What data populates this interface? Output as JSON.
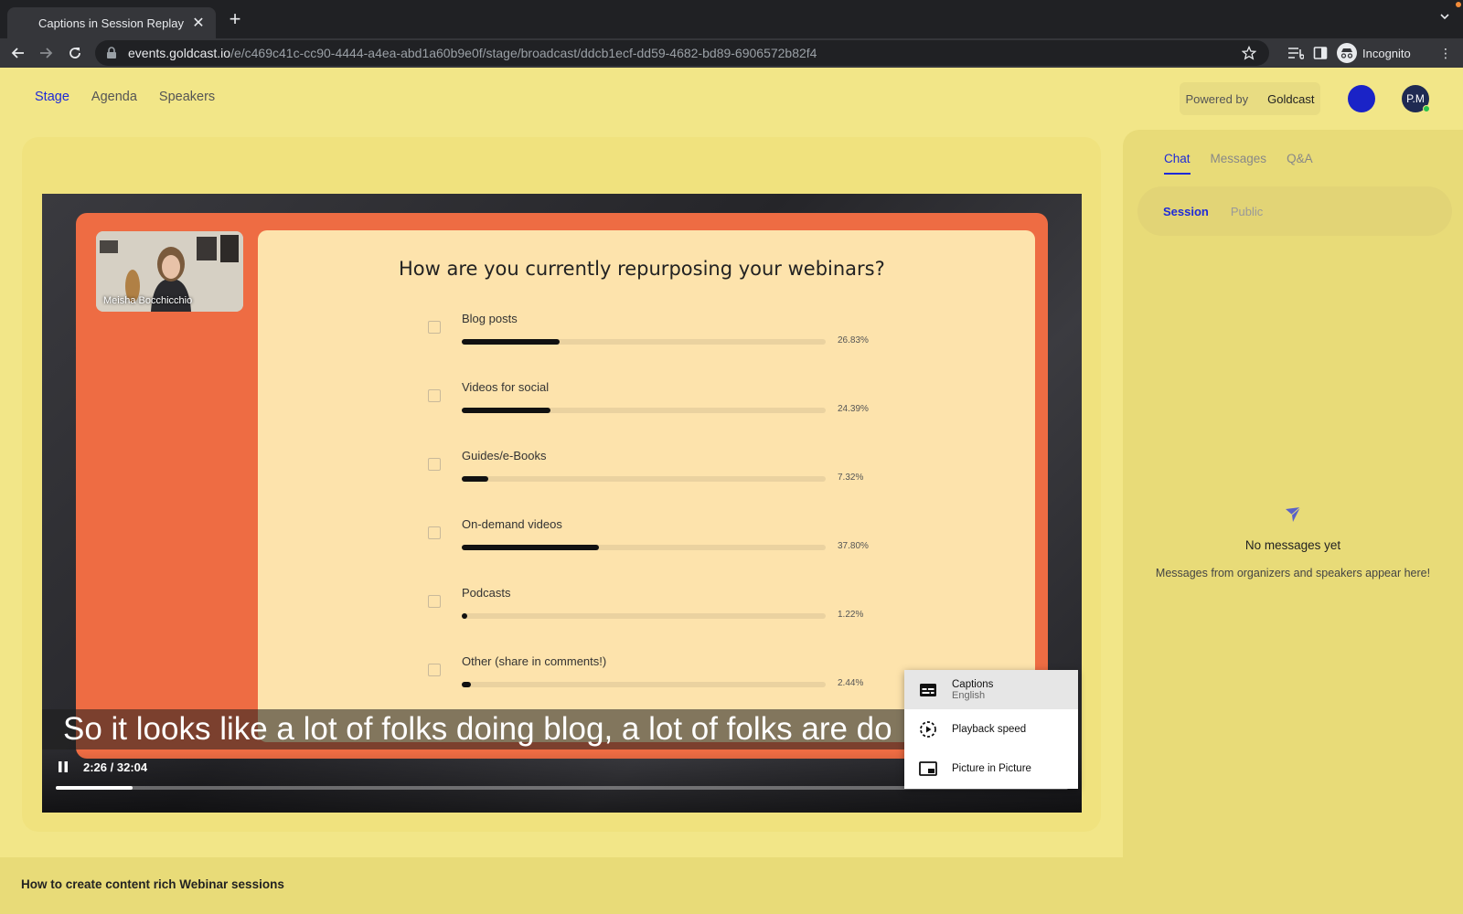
{
  "browser": {
    "tab_title": "Captions in Session Replay",
    "url_host": "events.goldcast.io",
    "url_path": "/e/c469c41c-cc90-4444-a4ea-abd1a60b9e0f/stage/broadcast/ddcb1ecf-dd59-4682-bd89-6906572b82f4",
    "incognito_label": "Incognito"
  },
  "header": {
    "nav": [
      "Stage",
      "Agenda",
      "Speakers"
    ],
    "active_nav": "Stage",
    "powered_by": "Powered by",
    "brand": "Goldcast",
    "user_initials": "P.M",
    "colors": {
      "accent": "#1e2ad8",
      "background": "#f2e688"
    }
  },
  "player": {
    "speaker_name": "Meisha Bocchicchio",
    "poll": {
      "question": "How are you currently repurposing your webinars?",
      "options": [
        {
          "label": "Blog posts",
          "percent": 26.83,
          "percent_text": "26.83%"
        },
        {
          "label": "Videos for social",
          "percent": 24.39,
          "percent_text": "24.39%"
        },
        {
          "label": "Guides/e-Books",
          "percent": 7.32,
          "percent_text": "7.32%"
        },
        {
          "label": "On-demand videos",
          "percent": 37.8,
          "percent_text": "37.80%"
        },
        {
          "label": "Podcasts",
          "percent": 1.22,
          "percent_text": "1.22%"
        },
        {
          "label": "Other (share in comments!)",
          "percent": 2.44,
          "percent_text": "2.44%"
        }
      ]
    },
    "caption_text": "So it looks like a lot of folks doing blog, a lot of folks are do",
    "time_display": "2:26 / 32:04",
    "progress_fraction": 0.0759,
    "menu": {
      "captions_label": "Captions",
      "captions_value": "English",
      "playback_speed_label": "Playback speed",
      "pip_label": "Picture in Picture"
    }
  },
  "sidebar": {
    "tabs": [
      "Chat",
      "Messages",
      "Q&A"
    ],
    "active_tab": "Chat",
    "subtabs": [
      "Session",
      "Public"
    ],
    "active_subtab": "Session",
    "empty_title": "No messages yet",
    "empty_subtitle": "Messages from organizers and speakers appear here!"
  },
  "footer": {
    "session_title": "How to create content rich Webinar sessions"
  }
}
